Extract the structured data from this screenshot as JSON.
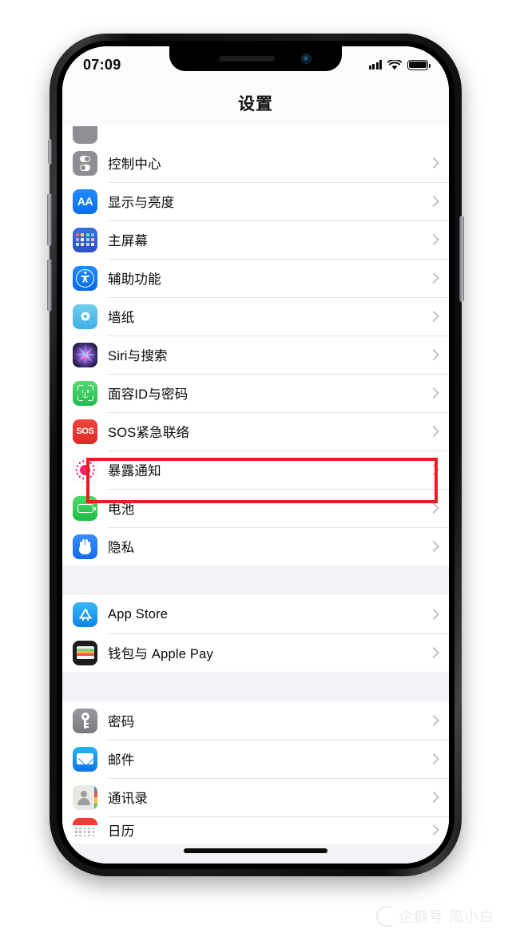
{
  "device": {
    "frame": "iphone-x-style",
    "notch": true
  },
  "status_bar": {
    "time": "07:09",
    "signal_icon": "cellular-signal-icon",
    "wifi_icon": "wifi-icon",
    "battery_icon": "battery-full-icon"
  },
  "nav": {
    "title": "设置"
  },
  "list": {
    "partial_top_row": {
      "label": ""
    },
    "groups": [
      {
        "rows": [
          {
            "label": "控制中心",
            "icon": "control-center-icon"
          },
          {
            "label": "显示与亮度",
            "icon": "display-brightness-icon",
            "icon_text": "AA"
          },
          {
            "label": "主屏幕",
            "icon": "home-screen-icon"
          },
          {
            "label": "辅助功能",
            "icon": "accessibility-icon"
          },
          {
            "label": "墙纸",
            "icon": "wallpaper-icon"
          },
          {
            "label": "Siri与搜索",
            "icon": "siri-search-icon"
          },
          {
            "label": "面容ID与密码",
            "icon": "face-id-icon"
          },
          {
            "label": "SOS紧急联络",
            "icon": "emergency-sos-icon",
            "icon_text": "SOS"
          },
          {
            "label": "暴露通知",
            "icon": "exposure-notifications-icon",
            "highlighted": true
          },
          {
            "label": "电池",
            "icon": "battery-icon"
          },
          {
            "label": "隐私",
            "icon": "privacy-icon"
          }
        ]
      },
      {
        "rows": [
          {
            "label": "App Store",
            "icon": "app-store-icon"
          },
          {
            "label": "钱包与 Apple Pay",
            "icon": "wallet-apple-pay-icon"
          }
        ]
      },
      {
        "rows": [
          {
            "label": "密码",
            "icon": "passwords-icon"
          },
          {
            "label": "邮件",
            "icon": "mail-icon"
          },
          {
            "label": "通讯录",
            "icon": "contacts-icon"
          },
          {
            "label": "日历",
            "icon": "calendar-icon"
          }
        ]
      }
    ],
    "chevron_icon": "chevron-right-icon"
  },
  "highlight": {
    "target_label": "暴露通知",
    "color": "#ec1c24"
  },
  "watermark": {
    "text": "企鹅号 简小白"
  }
}
